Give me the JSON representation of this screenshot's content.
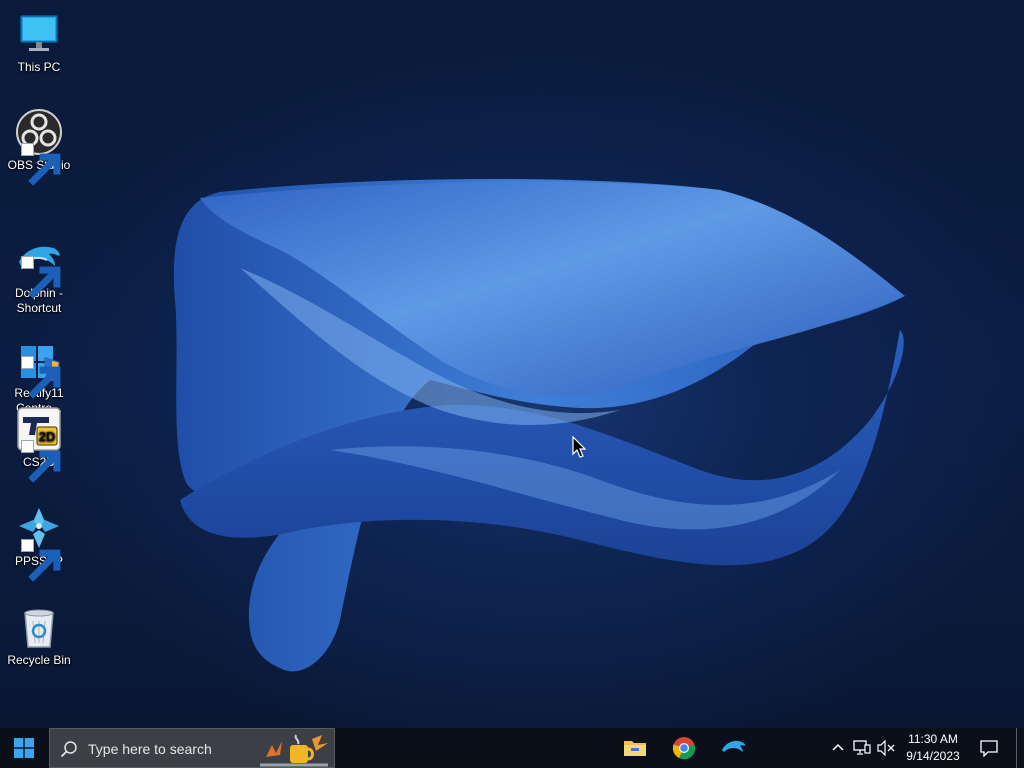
{
  "desktop": {
    "icons": [
      {
        "label": "This PC",
        "icon": "monitor-icon",
        "shortcut": false
      },
      {
        "label": "OBS Studio",
        "icon": "obs-icon",
        "shortcut": true
      },
      {
        "label": "Dolphin -\nShortcut",
        "icon": "dolphin-icon",
        "shortcut": true
      },
      {
        "label": "Rectify11\nContro...",
        "icon": "rectify11-icon",
        "shortcut": true
      },
      {
        "label": "CS2D",
        "icon": "cs2d-icon",
        "shortcut": true,
        "badge_text": "2D"
      },
      {
        "label": "PPSSPP",
        "icon": "ppsspp-icon",
        "shortcut": true
      },
      {
        "label": "Recycle Bin",
        "icon": "recycle-bin-icon",
        "shortcut": false
      }
    ]
  },
  "taskbar": {
    "start_icon": "windows-logo-icon",
    "search": {
      "placeholder": "Type here to search",
      "icon": "search-icon"
    },
    "pinned": [
      {
        "name": "File Explorer",
        "icon": "folder-icon"
      },
      {
        "name": "Google Chrome",
        "icon": "chrome-icon"
      },
      {
        "name": "Dolphin",
        "icon": "dolphin-icon"
      }
    ],
    "tray": {
      "icons": [
        "chevron-up-icon",
        "network-icon",
        "volume-muted-icon"
      ],
      "time": "11:30 AM",
      "date": "9/14/2023",
      "notification_icon": "notification-icon"
    }
  },
  "colors": {
    "desktop_background": "#0b1d42",
    "wallpaper_ribbon": "#3b7ad8",
    "taskbar": "#0b0f1a",
    "search_box": "#3c3f44"
  }
}
